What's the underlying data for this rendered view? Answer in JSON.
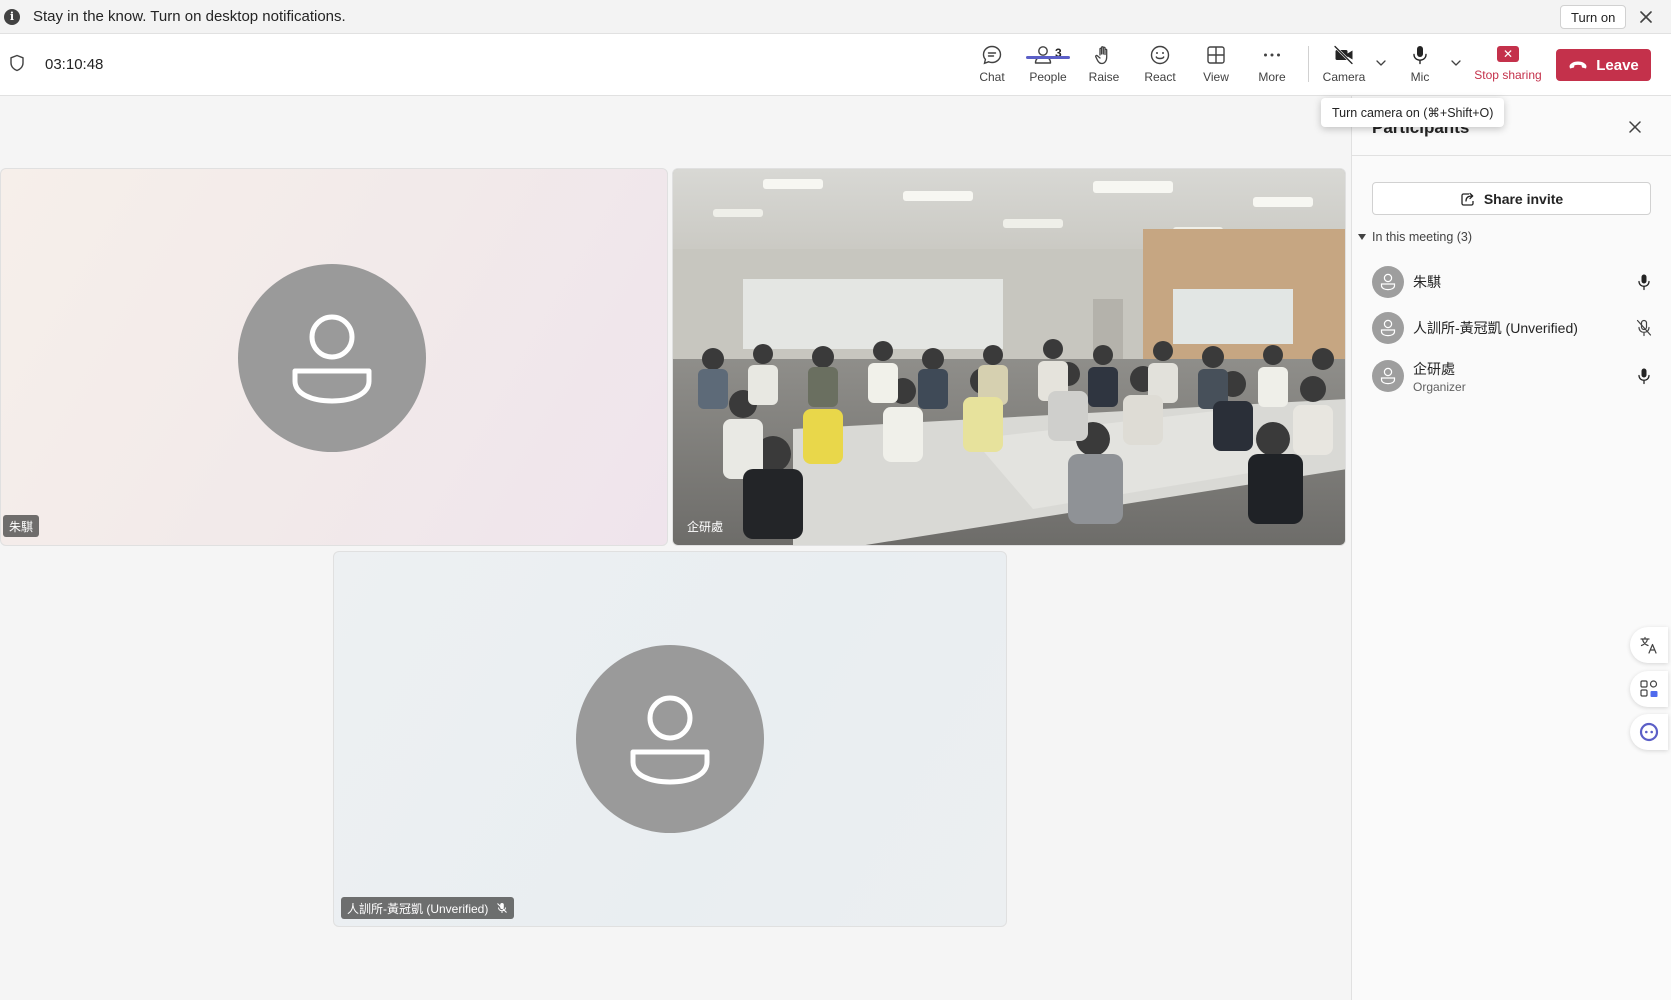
{
  "notification": {
    "text": "Stay in the know. Turn on desktop notifications.",
    "turn_on_label": "Turn on"
  },
  "toolbar": {
    "timer": "03:10:48",
    "chat_label": "Chat",
    "people_label": "People",
    "people_count": "3",
    "raise_label": "Raise",
    "react_label": "React",
    "view_label": "View",
    "more_label": "More",
    "camera_label": "Camera",
    "mic_label": "Mic",
    "stop_sharing_label": "Stop sharing",
    "leave_label": "Leave",
    "leave_color": "#c4314b",
    "accent_color": "#5b5fc7"
  },
  "tooltip": {
    "text": "Turn camera on (⌘+Shift+O)"
  },
  "stage": {
    "tiles": [
      {
        "name": "朱騏"
      },
      {
        "name": "企研處"
      },
      {
        "name": "人訓所-黃冠凱 (Unverified)"
      }
    ]
  },
  "participants_panel": {
    "title": "Participants",
    "share_invite_label": "Share invite",
    "section_label": "In this meeting (3)",
    "people": [
      {
        "name": "朱騏",
        "role": "",
        "mic": "on"
      },
      {
        "name": "人訓所-黃冠凱 (Unverified)",
        "role": "",
        "mic": "muted"
      },
      {
        "name": "企研處",
        "role": "Organizer",
        "mic": "on"
      }
    ]
  },
  "side_buttons": [
    "translate-icon",
    "apps-icon",
    "copilot-icon"
  ]
}
